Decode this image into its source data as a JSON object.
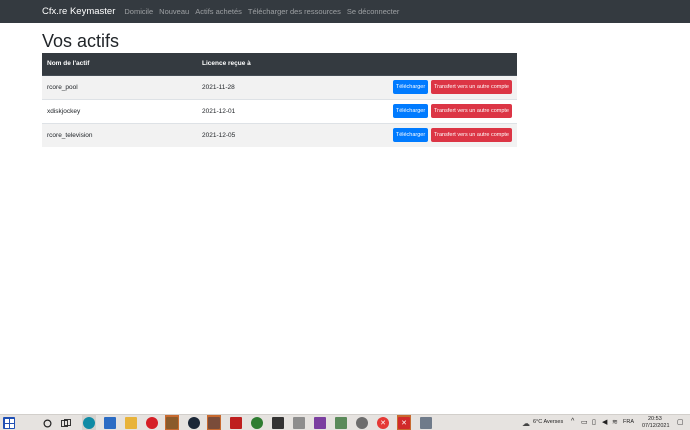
{
  "navbar": {
    "brand": "Cfx.re Keymaster",
    "links": [
      "Domicile",
      "Nouveau",
      "Actifs achetés",
      "Télécharger des ressources",
      "Se déconnecter"
    ]
  },
  "page": {
    "title": "Vos actifs"
  },
  "table": {
    "headers": [
      "Nom de l'actif",
      "Licence reçue à",
      ""
    ],
    "rows": [
      {
        "name": "rcore_pool",
        "date": "2021-11-28",
        "download": "Télécharger",
        "transfer": "Transfert vers un autre compte"
      },
      {
        "name": "xdiskjockey",
        "date": "2021-12-01",
        "download": "Télécharger",
        "transfer": "Transfert vers un autre compte"
      },
      {
        "name": "rcore_television",
        "date": "2021-12-05",
        "download": "Télécharger",
        "transfer": "Transfert vers un autre compte"
      }
    ]
  },
  "colors": {
    "navbar": "#343a40",
    "primary": "#007bff",
    "danger": "#dc3545",
    "striped_row": "#f2f2f2"
  },
  "taskbar": {
    "icons": [
      "windows-start-icon",
      "search-icon",
      "task-view-icon",
      "edge-icon",
      "store-icon",
      "folder-icon",
      "opera-icon",
      "app-icon",
      "steam-icon",
      "filezilla-icon",
      "xbox-icon",
      "notepad-icon",
      "winrar-icon",
      "files-icon",
      "game-icon",
      "app-icon",
      "close-app-icon",
      "close-app-icon",
      "app-icon",
      "app-icon"
    ],
    "weather": "6°C  Averses",
    "language": "FRA",
    "time": "20:53",
    "date": "07/12/2021"
  }
}
